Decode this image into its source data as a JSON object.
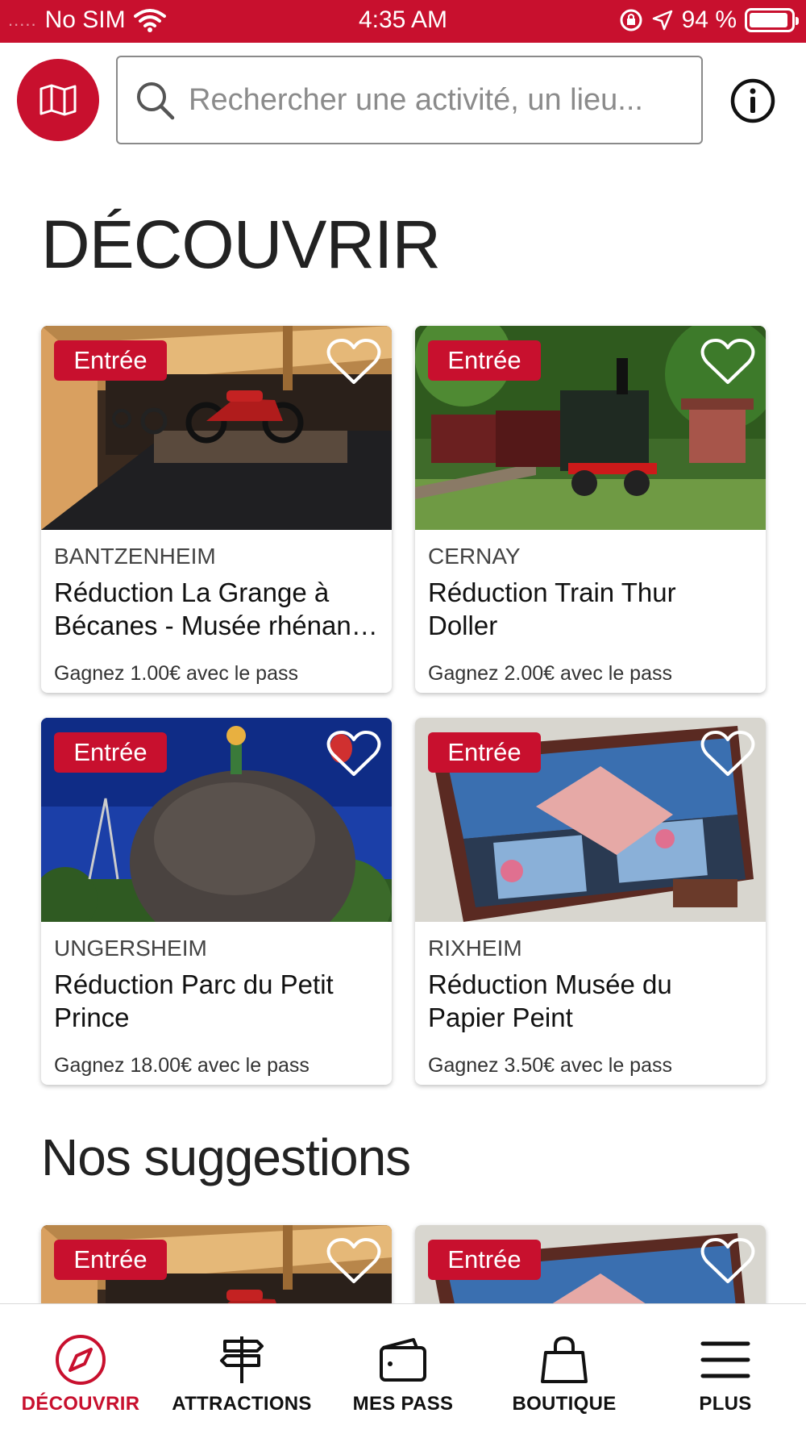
{
  "status_bar": {
    "carrier": "No SIM",
    "time": "4:35 AM",
    "battery_text": "94 %",
    "battery_level": 0.94,
    "signal_dots": "....."
  },
  "header": {
    "map_icon": "map-icon",
    "search_placeholder": "Rechercher une activité, un lieu...",
    "info_icon": "info-icon"
  },
  "colors": {
    "accent": "#c8102e"
  },
  "discover": {
    "title": "DÉCOUVRIR",
    "cards": [
      {
        "badge": "Entrée",
        "city": "BANTZENHEIM",
        "title_line1": "Réduction La Grange à",
        "title_line2": "Bécanes - Musée rhénan de la moto",
        "gain": "Gagnez 1.00€ avec le pass"
      },
      {
        "badge": "Entrée",
        "city": "CERNAY",
        "title_line1": "Réduction Train Thur",
        "title_line2": "Doller",
        "gain": "Gagnez 2.00€ avec le pass"
      },
      {
        "badge": "Entrée",
        "city": "UNGERSHEIM",
        "title_line1": "Réduction Parc du Petit",
        "title_line2": "Prince",
        "gain": "Gagnez 18.00€ avec le pass"
      },
      {
        "badge": "Entrée",
        "city": "RIXHEIM",
        "title_line1": "Réduction Musée du",
        "title_line2": "Papier Peint",
        "gain": "Gagnez 3.50€ avec le pass"
      }
    ]
  },
  "suggestions": {
    "title": "Nos suggestions",
    "cards": [
      {
        "badge": "Entrée"
      },
      {
        "badge": "Entrée"
      }
    ]
  },
  "tab_bar": {
    "tabs": [
      {
        "label": "DÉCOUVRIR",
        "icon": "compass-icon",
        "active": true
      },
      {
        "label": "ATTRACTIONS",
        "icon": "signpost-icon",
        "active": false
      },
      {
        "label": "MES PASS",
        "icon": "wallet-icon",
        "active": false
      },
      {
        "label": "BOUTIQUE",
        "icon": "shopping-bag-icon",
        "active": false
      },
      {
        "label": "PLUS",
        "icon": "menu-icon",
        "active": false
      }
    ]
  }
}
